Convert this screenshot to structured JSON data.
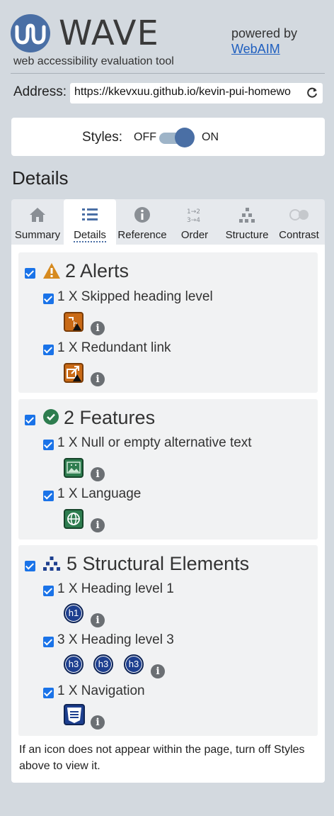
{
  "header": {
    "logo_text": "WAVE",
    "tagline": "web accessibility evaluation tool",
    "powered_by": "powered by",
    "webaim_link": "WebAIM"
  },
  "address": {
    "label": "Address:",
    "value": "https://kkevxuu.github.io/kevin-pui-homewo"
  },
  "styles": {
    "label": "Styles:",
    "off": "OFF",
    "on": "ON",
    "state": "on"
  },
  "details_heading": "Details",
  "tabs": [
    {
      "label": "Summary",
      "icon": "home-icon"
    },
    {
      "label": "Details",
      "icon": "list-icon",
      "active": true
    },
    {
      "label": "Reference",
      "icon": "info-icon"
    },
    {
      "label": "Order",
      "icon": "order-icon"
    },
    {
      "label": "Structure",
      "icon": "structure-icon"
    },
    {
      "label": "Contrast",
      "icon": "contrast-icon"
    }
  ],
  "groups": {
    "alerts": {
      "title": "2 Alerts",
      "items": [
        {
          "label": "1 X Skipped heading level",
          "icon": "skipped-heading-icon"
        },
        {
          "label": "1 X Redundant link",
          "icon": "redundant-link-icon"
        }
      ]
    },
    "features": {
      "title": "2 Features",
      "items": [
        {
          "label": "1 X Null or empty alternative text",
          "icon": "null-alt-icon"
        },
        {
          "label": "1 X Language",
          "icon": "language-icon"
        }
      ]
    },
    "structure": {
      "title": "5 Structural Elements",
      "items": [
        {
          "label": "1 X Heading level 1",
          "badges": [
            "h1"
          ]
        },
        {
          "label": "3 X Heading level 3",
          "badges": [
            "h3",
            "h3",
            "h3"
          ]
        },
        {
          "label": "1 X Navigation",
          "icon": "navigation-icon"
        }
      ]
    }
  },
  "info_glyph": "i",
  "footer_note": "If an icon does not appear within the page, turn off Styles above to view it.",
  "colors": {
    "accent": "#4a6fa5",
    "alert": "#c96a16",
    "feature": "#2e7d4f",
    "structure": "#1d3f8f",
    "checkbox": "#1a73e8"
  }
}
